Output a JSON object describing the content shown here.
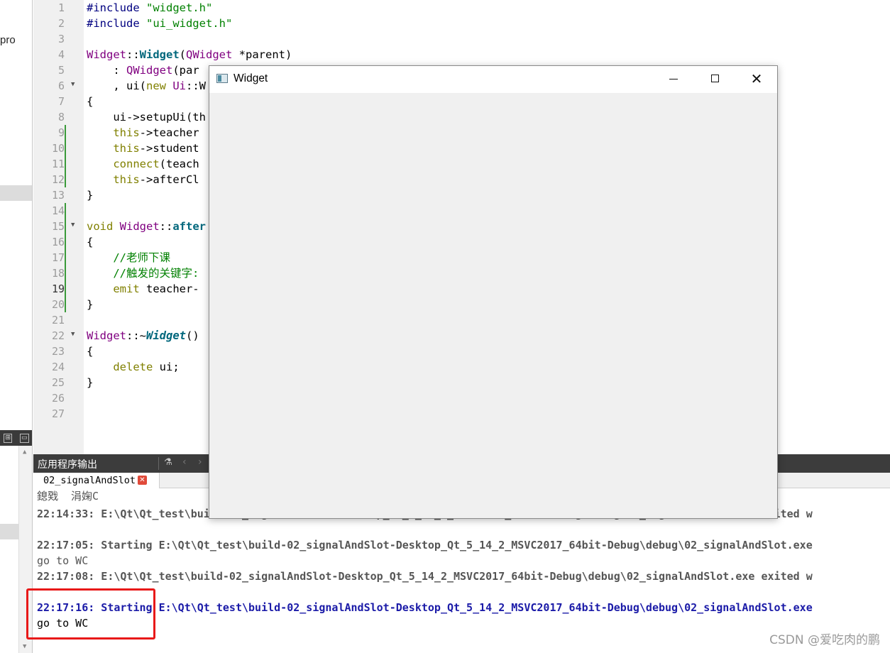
{
  "sidebar": {
    "project_fragment": "pro"
  },
  "editor": {
    "line_numbers": [
      "1",
      "2",
      "3",
      "4",
      "5",
      "6",
      "7",
      "8",
      "9",
      "10",
      "11",
      "12",
      "13",
      "14",
      "15",
      "16",
      "17",
      "18",
      "19",
      "20",
      "21",
      "22",
      "23",
      "24",
      "25",
      "26",
      "27"
    ],
    "current_line": "19",
    "code": {
      "l1_directive": "#include",
      "l1_string": " \"widget.h\"",
      "l2_directive": "#include",
      "l2_string": " \"ui_widget.h\"",
      "l4_class": "Widget",
      "l4_scope": "::",
      "l4_func": "Widget",
      "l4_paren": "(",
      "l4_type": "QWidget",
      "l4_rest": " *parent)",
      "l5_pre": "    : ",
      "l5_type": "QWidget",
      "l5_rest": "(par",
      "l6_pre": "    , ui(",
      "l6_kw": "new",
      "l6_sp": " ",
      "l6_type": "Ui",
      "l6_rest": "::W",
      "l7": "{",
      "l8": "    ui->setupUi(th",
      "l9_pre": "    ",
      "l9_kw": "this",
      "l9_rest": "->teacher",
      "l10_pre": "    ",
      "l10_kw": "this",
      "l10_rest": "->student",
      "l11_pre": "    ",
      "l11_kw": "connect",
      "l11_rest": "(teach",
      "l12_pre": "    ",
      "l12_kw": "this",
      "l12_rest": "->afterCl",
      "l13": "}",
      "l15_kw": "void",
      "l15_sp": " ",
      "l15_class": "Widget",
      "l15_scope": "::",
      "l15_func": "after",
      "l16": "{",
      "l17": "    //老师下课",
      "l18": "    //触发的关键字:",
      "l19_pre": "    ",
      "l19_kw": "emit",
      "l19_rest": " teacher-",
      "l20": "}",
      "l22_class": "Widget",
      "l22_scope": "::~",
      "l22_func": "Widget",
      "l22_rest": "()",
      "l23": "{",
      "l24_pre": "    ",
      "l24_kw": "delete",
      "l24_rest": " ui;",
      "l25": "}"
    }
  },
  "output": {
    "header_title": "应用程序输出",
    "tab_label": "02_signalAndSlot",
    "tab_close": "✕",
    "lines": {
      "garbled": "鎴戣  涓婅C",
      "exit1": "22:14:33: E:\\Qt\\Qt_test\\build-02_signalAndSlot-Desktop_Qt_5_14_2_MSVC2017_64bit-Debug\\debug\\02_signalAndSlot.exe exited w",
      "start2": "22:17:05: Starting E:\\Qt\\Qt_test\\build-02_signalAndSlot-Desktop_Qt_5_14_2_MSVC2017_64bit-Debug\\debug\\02_signalAndSlot.exe",
      "out2": "go to WC",
      "exit2": "22:17:08: E:\\Qt\\Qt_test\\build-02_signalAndSlot-Desktop_Qt_5_14_2_MSVC2017_64bit-Debug\\debug\\02_signalAndSlot.exe exited w",
      "start3": "22:17:16: Starting E:\\Qt\\Qt_test\\build-02_signalAndSlot-Desktop_Qt_5_14_2_MSVC2017_64bit-Debug\\debug\\02_signalAndSlot.exe",
      "out3": "go to WC"
    }
  },
  "window": {
    "title": "Widget",
    "close_glyph": "✕"
  },
  "watermark": "CSDN @爱吃肉的鹏",
  "colors": {
    "annotation_red": "#e81919",
    "output_header": "#3c3c3c"
  }
}
